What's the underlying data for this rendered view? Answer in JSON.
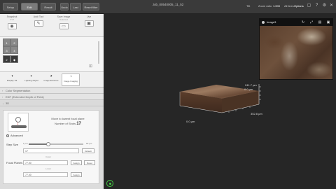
{
  "topbar": {
    "tabs": [
      {
        "label": "Setup",
        "active": false
      },
      {
        "label": "Edit",
        "active": true
      },
      {
        "label": "Result",
        "active": false
      }
    ],
    "left_buttons": [
      "Undo",
      "Last read",
      "Reset filter"
    ],
    "title": "Job_00540005_11_52",
    "zoom_label": "Zoom ratio",
    "zoom_value": "1.000",
    "extra_label": "All lines",
    "options_label": "Options"
  },
  "tools": [
    {
      "label": "Snapshot",
      "sub": "XYZ",
      "icon": "camera-icon",
      "glyph": "◉"
    },
    {
      "label": "Add/ Tool",
      "sub": "",
      "icon": "pen-icon",
      "glyph": "✎"
    },
    {
      "label": "Save Image",
      "sub": "Selected",
      "icon": "save-icon",
      "glyph": "▭"
    },
    {
      "label": "Live",
      "sub": "",
      "icon": "live-icon",
      "glyph": "▣"
    }
  ],
  "objectives": [
    {
      "label": "1",
      "dark": false
    },
    {
      "label": "2",
      "dark": false
    },
    {
      "label": "3",
      "dark": false
    },
    {
      "label": "4",
      "dark": true
    }
  ],
  "modes": [
    {
      "label": "Display Tilt",
      "icon": "tilt-icon",
      "glyph": "◑",
      "active": false
    },
    {
      "label": "Lighting Adjust",
      "icon": "light-icon",
      "glyph": "◐",
      "active": false
    },
    {
      "label": "Image Enhance",
      "icon": "enhance-icon",
      "glyph": "◕",
      "active": false
    },
    {
      "label": "Image Imaging",
      "icon": "imaging-icon",
      "glyph": "◔",
      "active": true
    }
  ],
  "accordion": [
    {
      "label": "Color Segmentation",
      "open": false
    },
    {
      "label": "EDF (Extended Depth of Field)",
      "open": false
    },
    {
      "label": "3D",
      "open": true
    }
  ],
  "panel3d": {
    "move_text": "Move to lowest focal plane",
    "shots_label": "Number of Shots",
    "shots_value": "17",
    "advanced_label": "Advanced",
    "step_label": "Step Size",
    "slider_min": "1 µm",
    "slider_max": "50 µm",
    "slider_fraction": 0.36,
    "step_value": "17",
    "default_label": "Default",
    "upper_label": "Upper",
    "focal_label": "Focal Planes",
    "fp_upper": "77.00",
    "fp_lower": "77.00",
    "assign_label": "Assign",
    "reset_label": "Reset",
    "lower_label": "Lower"
  },
  "viewport": {
    "mini_title": "Image3",
    "dims": {
      "z_top": "241.7 µm",
      "z_bottom": "0.0 µm",
      "x": "352.8 µm",
      "origin": "0.0 µm"
    }
  }
}
